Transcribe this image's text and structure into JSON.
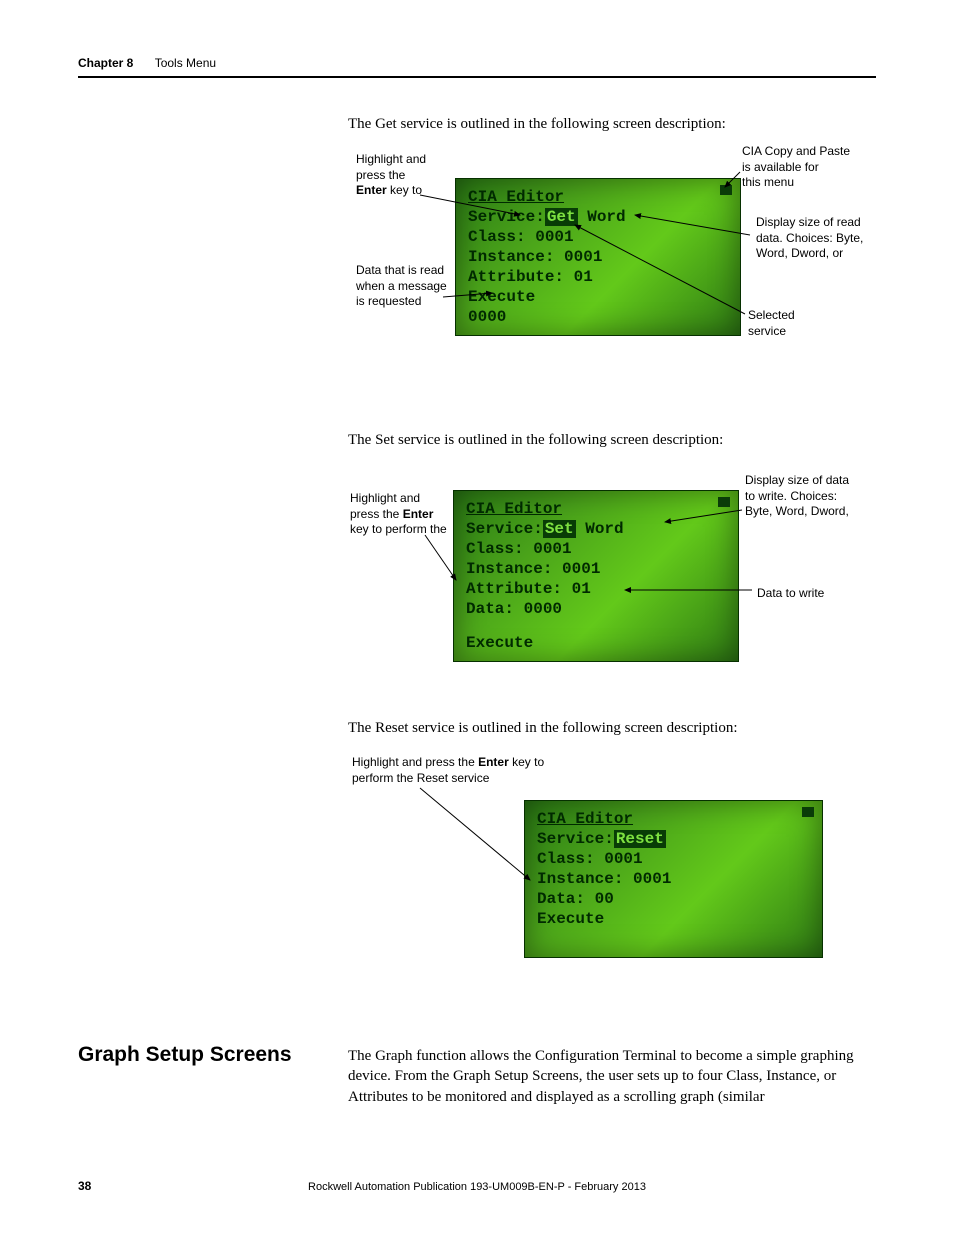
{
  "header": {
    "chapter": "Chapter 8",
    "section": "Tools Menu"
  },
  "get": {
    "intro": "The Get service is outlined in the following screen description:",
    "lcd": {
      "title": "CIA Editor",
      "l1a": "Service:",
      "l1b": "Get",
      "l1c": " Word",
      "l2": "Class:  0001",
      "l3": "Instance:  0001",
      "l4": "Attribute:  01",
      "l5": "Execute",
      "l6": "0000"
    },
    "ann": {
      "a1a": "Highlight and",
      "a1b": "press the",
      "a1c_pre": "",
      "a1c_bold": "Enter",
      "a1c_post": " key to",
      "a2a": "Data that is read",
      "a2b": "when a message",
      "a2c": "is requested",
      "a3a": "CIA Copy and Paste",
      "a3b": "is available for",
      "a3c": "this menu",
      "a4a": "Display size of read",
      "a4b": "data. Choices: Byte,",
      "a4c": "Word, Dword, or",
      "a5a": "Selected",
      "a5b": "service"
    }
  },
  "set": {
    "intro": "The Set service is outlined in the following screen description:",
    "lcd": {
      "title": "CIA Editor",
      "l1a": "Service:",
      "l1b": "Set",
      "l1c": " Word",
      "l2": "Class:  0001",
      "l3": "Instance:  0001",
      "l4": "Attribute:  01",
      "l5": "Data:  0000",
      "l6": "",
      "l7": "Execute"
    },
    "ann": {
      "a1a": "Highlight and",
      "a1b_pre": "press the ",
      "a1b_bold": "Enter",
      "a1c": "key to perform the",
      "a2a": "Display size of data",
      "a2b": "to write. Choices:",
      "a2c": "Byte, Word, Dword,",
      "a3": "Data to write"
    }
  },
  "reset": {
    "intro": "The Reset service is outlined in the following screen description:",
    "ann": {
      "a1_pre": "Highlight and press the ",
      "a1_bold": "Enter",
      "a1_post": " key to",
      "a2": "perform the Reset service"
    },
    "lcd": {
      "title": "CIA Editor",
      "l1a": "Service:",
      "l1b": "Reset",
      "l2": "Class:  0001",
      "l3": "Instance:  0001",
      "l4": "Data:   00",
      "l5": "Execute"
    }
  },
  "graph": {
    "title": "Graph Setup Screens",
    "body": "The Graph function allows the Configuration Terminal to become a simple graphing device. From the Graph Setup Screens, the user sets up to four Class, Instance, or Attributes to be monitored and displayed as a scrolling graph (similar"
  },
  "footer": {
    "page": "38",
    "pub": "Rockwell Automation Publication 193-UM009B-EN-P - February 2013"
  }
}
